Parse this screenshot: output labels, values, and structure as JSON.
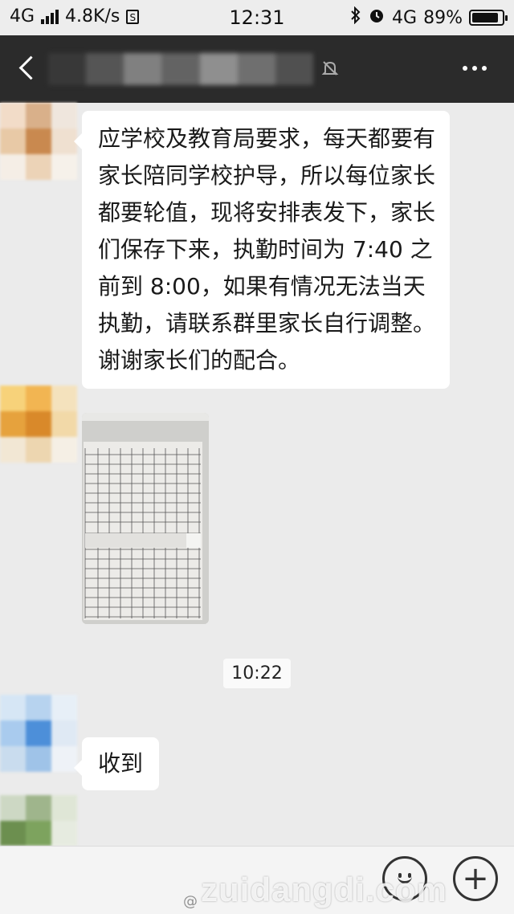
{
  "status_bar": {
    "network": "4G",
    "speed": "4.8K/s",
    "sim_badge": "S",
    "time": "12:31",
    "network_right": "4G",
    "battery_percent": "89%",
    "battery_level": 0.89
  },
  "header": {
    "icons": [
      "back-arrow-icon",
      "mute-icon",
      "more-icon"
    ]
  },
  "messages": [
    {
      "type": "text",
      "text": "应学校及教育局要求，每天都要有家长陪同学校护导，所以每位家长都要轮值，现将安排表发下，家长们保存下来，执勤时间为 7:40 之前到 8:00，如果有情况无法当天执勤，请联系群里家长自行调整。谢谢家长们的配合。"
    },
    {
      "type": "image",
      "alt": ""
    },
    {
      "type": "time",
      "text": "10:22"
    },
    {
      "type": "text",
      "text": "收到"
    }
  ],
  "input_bar": {
    "icons": [
      "emoji-icon",
      "plus-icon"
    ],
    "plus_symbol": "+"
  },
  "watermark": {
    "site": "zuidangdi.com",
    "weibo": "@"
  },
  "colors": {
    "header_bg": "#2b2b2b",
    "chat_bg": "#ebebeb",
    "bubble_bg": "#ffffff"
  }
}
